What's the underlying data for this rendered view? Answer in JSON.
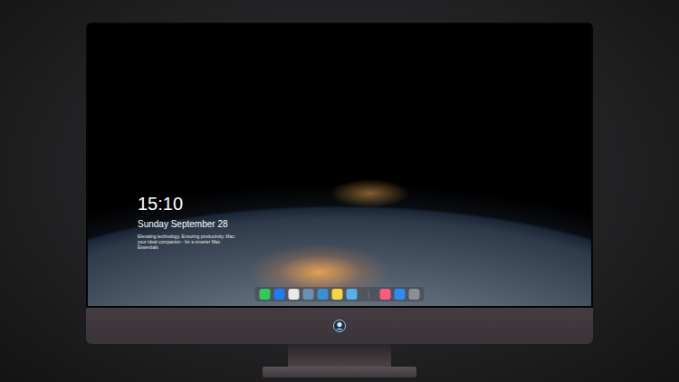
{
  "lock_screen": {
    "time": "15:10",
    "date": "Sunday September 28",
    "tagline": "Elevating technology. Ensuring productivity. Mac: your ideal companion - for a smarter Mac Essentials"
  },
  "dock": {
    "apps": [
      {
        "kind": "app",
        "color": "#34c759"
      },
      {
        "kind": "app",
        "color": "#1e7cf0"
      },
      {
        "kind": "app",
        "color": "#e9e9e9"
      },
      {
        "kind": "app",
        "color": "#6c8fb3"
      },
      {
        "kind": "app",
        "color": "#3a8fd6"
      },
      {
        "kind": "app",
        "color": "#f5d547"
      },
      {
        "kind": "app",
        "color": "#5ab0e8"
      },
      {
        "kind": "separator",
        "color": "#8e8e93"
      },
      {
        "kind": "app",
        "color": "#fa5c7c"
      },
      {
        "kind": "app",
        "color": "#2d8cf0"
      },
      {
        "kind": "app",
        "color": "#8e8e93"
      }
    ]
  }
}
